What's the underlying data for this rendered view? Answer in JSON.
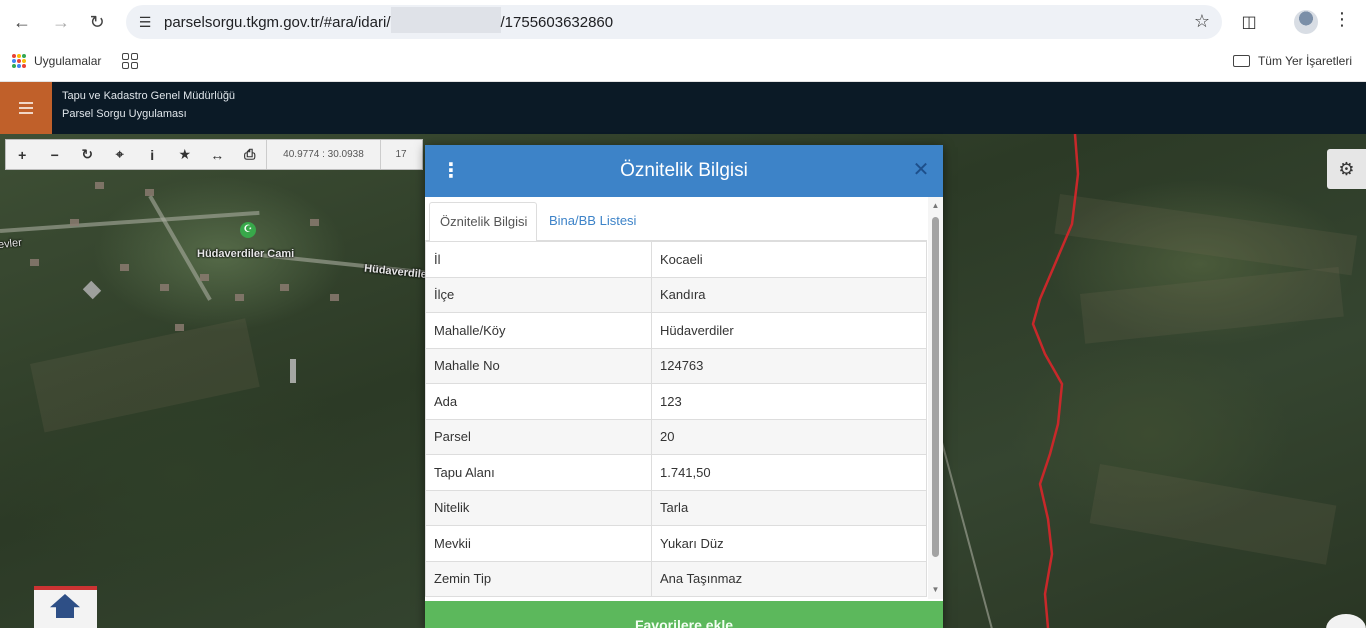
{
  "browser": {
    "url_prefix": "parselsorgu.tkgm.gov.tr/#ara/idari/",
    "url_suffix": "/1755603632860",
    "bookmarks_apps": "Uygulamalar",
    "bookmarks_right": "Tüm Yer İşaretleri"
  },
  "app": {
    "title_line1": "Tapu ve Kadastro Genel Müdürlüğü",
    "title_line2": "Parsel Sorgu Uygulaması"
  },
  "toolbar": {
    "coordinates": "40.9774 : 30.0938",
    "zoom": "17"
  },
  "map": {
    "labels": {
      "mosque": "Hüdaverdiler Cami",
      "road1": "Hüdaverdiler",
      "edge": "evler"
    }
  },
  "dialog": {
    "title": "Öznitelik Bilgisi",
    "tabs": [
      "Öznitelik Bilgisi",
      "Bina/BB Listesi"
    ],
    "rows": [
      {
        "key": "İl",
        "value": "Kocaeli"
      },
      {
        "key": "İlçe",
        "value": "Kandıra"
      },
      {
        "key": "Mahalle/Köy",
        "value": "Hüdaverdiler"
      },
      {
        "key": "Mahalle No",
        "value": "124763"
      },
      {
        "key": "Ada",
        "value": "123"
      },
      {
        "key": "Parsel",
        "value": "20"
      },
      {
        "key": "Tapu Alanı",
        "value": "1.741,50"
      },
      {
        "key": "Nitelik",
        "value": "Tarla"
      },
      {
        "key": "Mevkii",
        "value": "Yukarı Düz"
      },
      {
        "key": "Zemin Tip",
        "value": "Ana Taşınmaz"
      }
    ],
    "favorites_button": "Favorilere ekle"
  },
  "colors": {
    "header_blue": "#3d83c8",
    "app_header": "#0b1a26",
    "accent_orange": "#c0602a",
    "button_green": "#5cb85c",
    "parcel_boundary": "#c8282a"
  }
}
